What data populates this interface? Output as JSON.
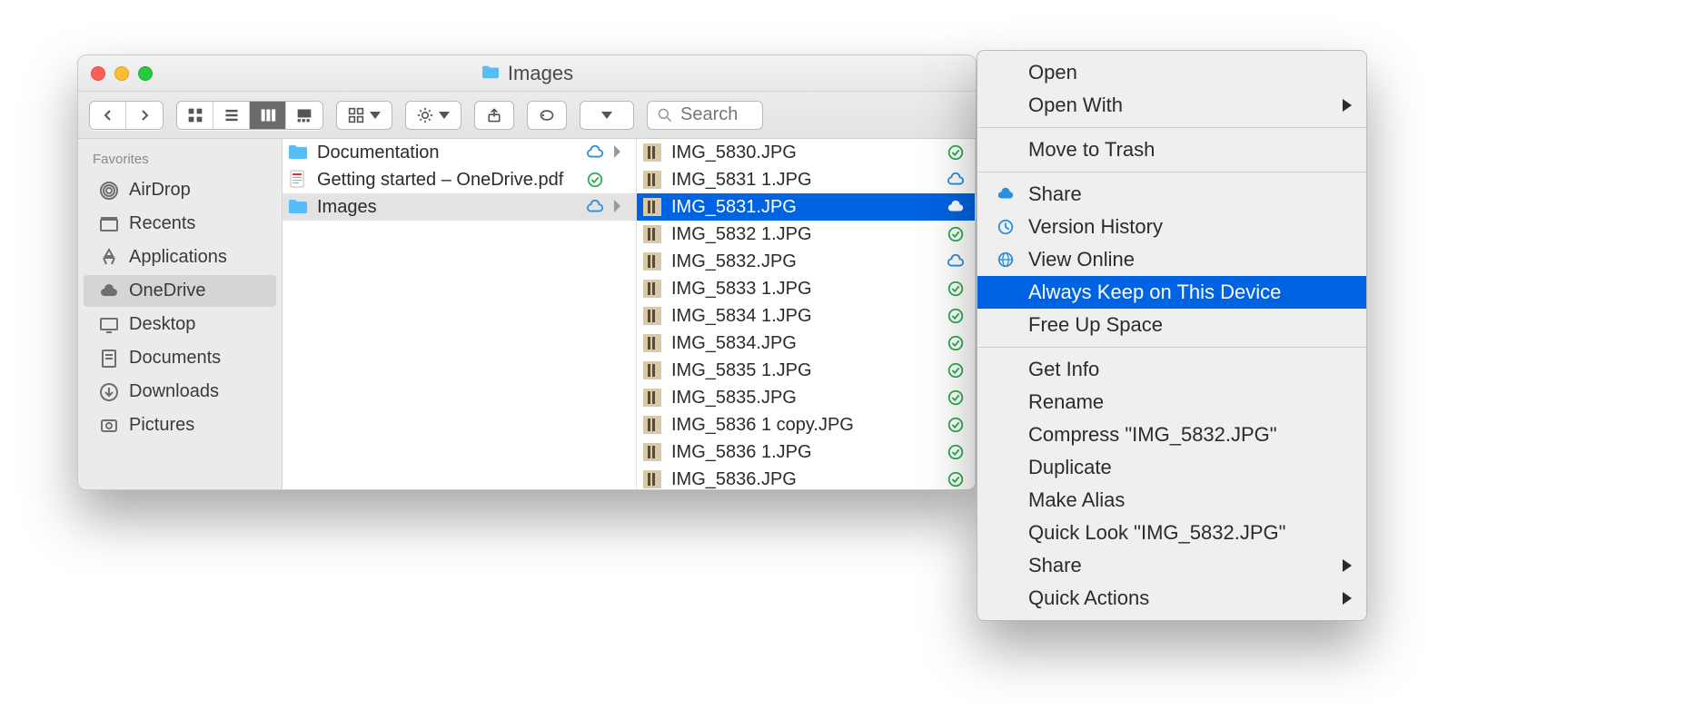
{
  "titlebar": {
    "title": "Images"
  },
  "toolbar": {
    "search_placeholder": "Search"
  },
  "sidebar": {
    "header": "Favorites",
    "items": [
      {
        "label": "AirDrop",
        "icon": "airdrop"
      },
      {
        "label": "Recents",
        "icon": "recents"
      },
      {
        "label": "Applications",
        "icon": "apps"
      },
      {
        "label": "OneDrive",
        "icon": "cloud",
        "selected": true
      },
      {
        "label": "Desktop",
        "icon": "desktop"
      },
      {
        "label": "Documents",
        "icon": "documents"
      },
      {
        "label": "Downloads",
        "icon": "downloads"
      },
      {
        "label": "Pictures",
        "icon": "pictures"
      }
    ]
  },
  "column1": [
    {
      "label": "Documentation",
      "type": "folder",
      "status": "cloud-outline",
      "arrow": true
    },
    {
      "label": "Getting started – OneDrive.pdf",
      "type": "pdf",
      "status": "synced"
    },
    {
      "label": "Images",
      "type": "folder",
      "status": "cloud-outline",
      "arrow": true,
      "selected": true
    }
  ],
  "column2": [
    {
      "label": "IMG_5830.JPG",
      "status": "synced"
    },
    {
      "label": "IMG_5831 1.JPG",
      "status": "cloud-outline"
    },
    {
      "label": "IMG_5831.JPG",
      "status": "cloud-white",
      "selected": true
    },
    {
      "label": "IMG_5832 1.JPG",
      "status": "synced"
    },
    {
      "label": "IMG_5832.JPG",
      "status": "cloud-outline"
    },
    {
      "label": "IMG_5833 1.JPG",
      "status": "synced"
    },
    {
      "label": "IMG_5834 1.JPG",
      "status": "synced"
    },
    {
      "label": "IMG_5834.JPG",
      "status": "synced"
    },
    {
      "label": "IMG_5835 1.JPG",
      "status": "synced"
    },
    {
      "label": "IMG_5835.JPG",
      "status": "synced"
    },
    {
      "label": "IMG_5836 1 copy.JPG",
      "status": "synced"
    },
    {
      "label": "IMG_5836 1.JPG",
      "status": "synced"
    },
    {
      "label": "IMG_5836.JPG",
      "status": "synced"
    }
  ],
  "context_menu": {
    "groups": [
      [
        {
          "label": "Open"
        },
        {
          "label": "Open With",
          "submenu": true
        }
      ],
      [
        {
          "label": "Move to Trash"
        }
      ],
      [
        {
          "label": "Share",
          "icon": "cloud-blue"
        },
        {
          "label": "Version History",
          "icon": "history"
        },
        {
          "label": "View Online",
          "icon": "globe"
        },
        {
          "label": "Always Keep on This Device",
          "highlight": true
        },
        {
          "label": "Free Up Space"
        }
      ],
      [
        {
          "label": "Get Info"
        },
        {
          "label": "Rename"
        },
        {
          "label": "Compress \"IMG_5832.JPG\""
        },
        {
          "label": "Duplicate"
        },
        {
          "label": "Make Alias"
        },
        {
          "label": "Quick Look \"IMG_5832.JPG\""
        },
        {
          "label": "Share",
          "submenu": true
        },
        {
          "label": "Quick Actions",
          "submenu": true
        }
      ]
    ]
  }
}
